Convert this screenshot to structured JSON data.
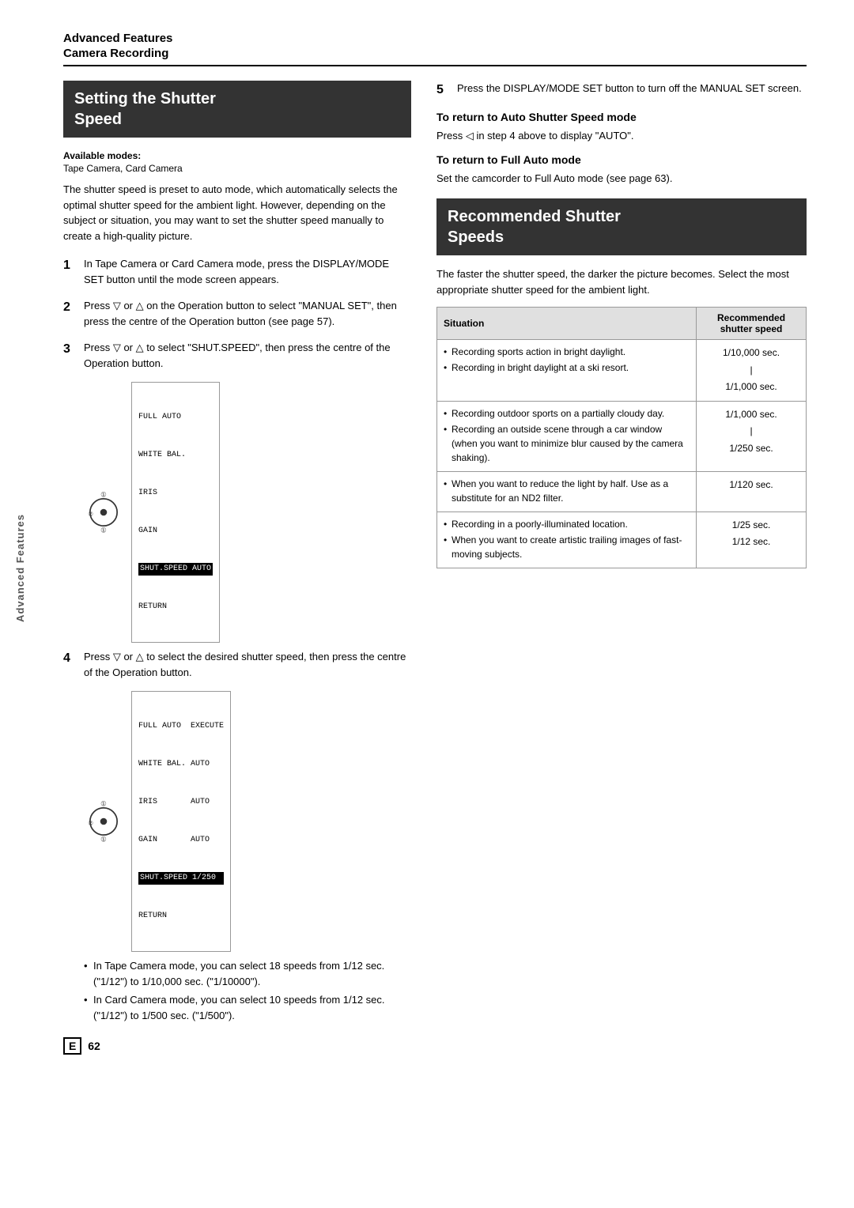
{
  "sidebar": {
    "label": "Advanced Features"
  },
  "header": {
    "category_line1": "Advanced Features",
    "category_line2": "Camera Recording",
    "rule": true
  },
  "title_box": {
    "line1": "Setting the Shutter",
    "line2": "Speed"
  },
  "available_modes": {
    "label": "Available modes:",
    "value": "Tape Camera, Card Camera"
  },
  "intro": "The shutter speed is preset to auto mode, which automatically selects the optimal shutter speed for the ambient light. However, depending on the subject or situation, you may want to set the shutter speed manually to create a high-quality picture.",
  "steps": [
    {
      "num": "1",
      "text": "In Tape Camera or Card Camera mode, press the DISPLAY/MODE SET button until the mode screen appears."
    },
    {
      "num": "2",
      "text": "Press ▽ or △ on the Operation button to select \"MANUAL SET\", then press the centre of the Operation button (see page 57)."
    },
    {
      "num": "3",
      "text": "Press ▽ or △ to select \"SHUT.SPEED\", then press the centre of the Operation button."
    },
    {
      "num": "4",
      "text": "Press ▽ or △ to select the desired shutter speed, then press the centre of the Operation button."
    }
  ],
  "diagram1": {
    "menu_lines": [
      "FULL AUTO",
      "WHITE BAL.",
      "IRIS",
      "GAIN",
      "SHUT.SPEED AUTO",
      "RETURN"
    ],
    "highlight_line": "SHUT.SPEED AUTO"
  },
  "diagram2": {
    "menu_lines": [
      "FULL AUTO  EXECUTE",
      "WHITE BAL. AUTO",
      "IRIS       AUTO",
      "GAIN       AUTO",
      "SHUT.SPEED 1/250",
      "RETURN"
    ],
    "highlight_line": "SHUT.SPEED 1/250"
  },
  "bullets": [
    "In Tape Camera mode, you can select 18 speeds from 1/12 sec. (\"1/12\") to 1/10,000 sec. (\"1/10000\").",
    "In Card Camera mode, you can select 10 speeds from 1/12 sec. (\"1/12\") to 1/500 sec. (\"1/500\")."
  ],
  "page_num": "62",
  "page_e": "E",
  "right": {
    "step5_text": "Press the DISPLAY/MODE SET button to turn off the MANUAL SET screen.",
    "step5_num": "5",
    "sub1_heading": "To return to Auto Shutter Speed mode",
    "sub1_text": "Press ◁ in step 4 above to display \"AUTO\".",
    "sub2_heading": "To return to Full Auto mode",
    "sub2_text": "Set the camcorder to Full Auto mode (see page 63).",
    "rec_section_title_line1": "Recommended Shutter",
    "rec_section_title_line2": "Speeds",
    "rec_intro": "The faster the shutter speed, the darker the picture becomes. Select the most appropriate shutter speed for the ambient light.",
    "table": {
      "col1_header": "Situation",
      "col2_header": "Recommended shutter speed",
      "rows": [
        {
          "situation": [
            "Recording sports action in bright daylight.",
            "Recording in bright daylight at a ski resort."
          ],
          "speed": "1/10,000 sec.\n|\n1/1,000 sec."
        },
        {
          "situation": [
            "Recording outdoor sports on a partially cloudy day.",
            "Recording an outside scene through a car window (when you want to minimize blur caused by the camera shaking)."
          ],
          "speed": "1/1,000 sec.\n|\n1/250 sec."
        },
        {
          "situation": [
            "When you want to reduce the light by half. Use as a substitute for an ND2 filter."
          ],
          "speed": "1/120 sec."
        },
        {
          "situation": [
            "Recording in a poorly-illuminated location.",
            "When you want to create artistic trailing images of fast-moving subjects."
          ],
          "speed": "1/25 sec.\n1/12 sec."
        }
      ]
    }
  }
}
